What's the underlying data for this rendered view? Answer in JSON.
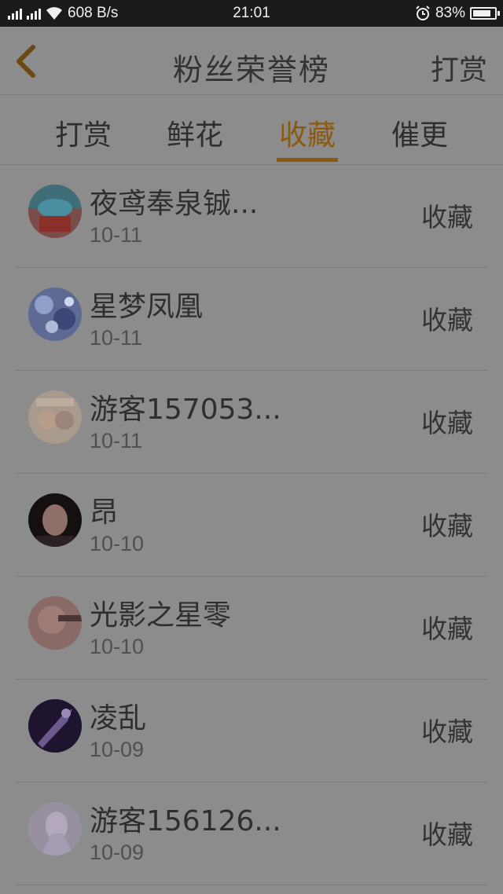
{
  "status_bar": {
    "network_speed": "608 B/s",
    "time": "21:01",
    "battery": "83%",
    "battery_level": 0.83,
    "network_type": "3G"
  },
  "header": {
    "title": "粉丝荣誉榜",
    "action_label": "打赏"
  },
  "tabs": [
    {
      "label": "打赏"
    },
    {
      "label": "鲜花"
    },
    {
      "label": "收藏"
    },
    {
      "label": "催更"
    }
  ],
  "active_tab": 2,
  "list": [
    {
      "name": "夜鸢奉泉铖...",
      "date": "10-11",
      "action": "收藏"
    },
    {
      "name": "星梦凤凰",
      "date": "10-11",
      "action": "收藏"
    },
    {
      "name": "游客157053...",
      "date": "10-11",
      "action": "收藏"
    },
    {
      "name": "昂",
      "date": "10-10",
      "action": "收藏"
    },
    {
      "name": "光影之星零",
      "date": "10-10",
      "action": "收藏"
    },
    {
      "name": "凌乱",
      "date": "10-09",
      "action": "收藏"
    },
    {
      "name": "游客156126...",
      "date": "10-09",
      "action": "收藏"
    }
  ],
  "colors": {
    "accent": "#8b5a10",
    "overlay_background": "#8c8c8c"
  }
}
